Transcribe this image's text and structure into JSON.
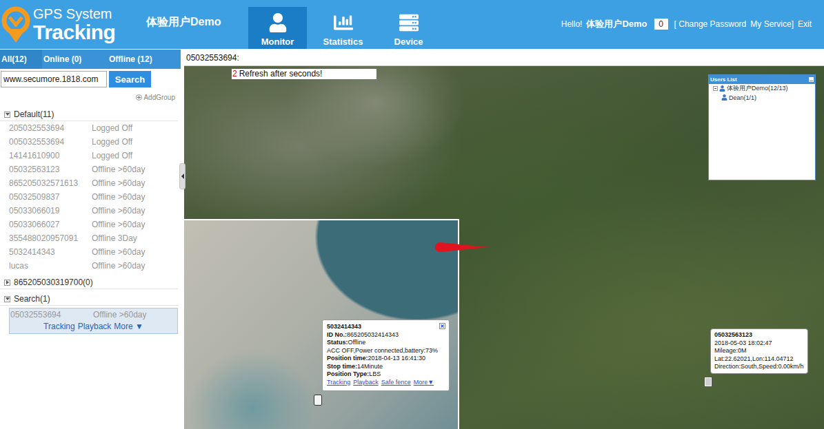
{
  "header": {
    "logo": {
      "line1": "GPS System",
      "line2": "Tracking"
    },
    "account": "体验用户Demo",
    "nav": [
      {
        "label": "Monitor",
        "selected": true
      },
      {
        "label": "Statistics",
        "selected": false
      },
      {
        "label": "Device",
        "selected": false
      }
    ],
    "greeting": "Hello!",
    "user": "体验用户Demo",
    "message_count": "0",
    "links": [
      "[ Change Password",
      "My Service]",
      "Exit"
    ]
  },
  "sidebar": {
    "filter_tabs": [
      {
        "label": "All(12)",
        "selected": true
      },
      {
        "label": "Online (0)",
        "selected": false
      },
      {
        "label": "Offline (12)",
        "selected": false
      }
    ],
    "search": {
      "value": "www.secumore.1818.com",
      "button": "Search"
    },
    "add_group": "AddGroup",
    "groups": [
      {
        "name": "Default(11)",
        "expanded": true,
        "devices": [
          {
            "name": "205032553694",
            "status": "Logged Off",
            "selected": false
          },
          {
            "name": "005032553694",
            "status": "Logged Off",
            "selected": false
          },
          {
            "name": "14141610900",
            "status": "Logged Off",
            "selected": false
          },
          {
            "name": "05032563123",
            "status": "Offline >60day",
            "selected": false
          },
          {
            "name": "865205032571613",
            "status": "Offline >60day",
            "selected": false
          },
          {
            "name": "05032509837",
            "status": "Offline >60day",
            "selected": false
          },
          {
            "name": "05033066019",
            "status": "Offline >60day",
            "selected": false
          },
          {
            "name": "05033066027",
            "status": "Offline >60day",
            "selected": false
          },
          {
            "name": "355488020957091",
            "status": "Offline 3Day",
            "selected": false
          },
          {
            "name": "5032414343",
            "status": "Offline >60day",
            "selected": false
          },
          {
            "name": "lucas",
            "status": "Offline >60day",
            "selected": false
          }
        ]
      },
      {
        "name": "865205030319700(0)",
        "expanded": false,
        "devices": []
      },
      {
        "name": "Search(1)",
        "expanded": true,
        "devices": [
          {
            "name": "05032553694",
            "status": "Offline >60day",
            "selected": true,
            "actions": [
              "Tracking",
              "Playback",
              "More ▼"
            ]
          }
        ]
      }
    ]
  },
  "monitor": {
    "title": "05032553694:",
    "refresh": {
      "count": "2",
      "text": "Refresh after seconds!"
    },
    "users_list": {
      "title": "Users List",
      "tree": [
        {
          "label": "体验用户Demo(12/13)",
          "expanded": true,
          "children": [
            {
              "label": "Dean(1/1)"
            }
          ]
        }
      ]
    },
    "device_popup": {
      "title": "5032414343",
      "fields": [
        {
          "label": "ID No.:",
          "value": "865205032414343"
        },
        {
          "label": "Status:",
          "value": "Offline"
        },
        {
          "label": "",
          "value": "ACC OFF,Power connected,battery:73%"
        },
        {
          "label": "Position time:",
          "value": "2018-04-13 16:41:30"
        },
        {
          "label": "Stop time:",
          "value": "14Minute"
        },
        {
          "label": "Position Type:",
          "value": "LBS"
        }
      ],
      "links": [
        "Tracking",
        "Playback",
        "Safe fence",
        "More▼"
      ]
    },
    "device_tooltip": {
      "title": "05032563123",
      "lines": [
        "2018-05-03 18:02:47",
        "Mileage:0M",
        "Lat:22.62021,Lon:114.04712",
        "Direction:South,Speed:0.00km/h"
      ]
    }
  }
}
